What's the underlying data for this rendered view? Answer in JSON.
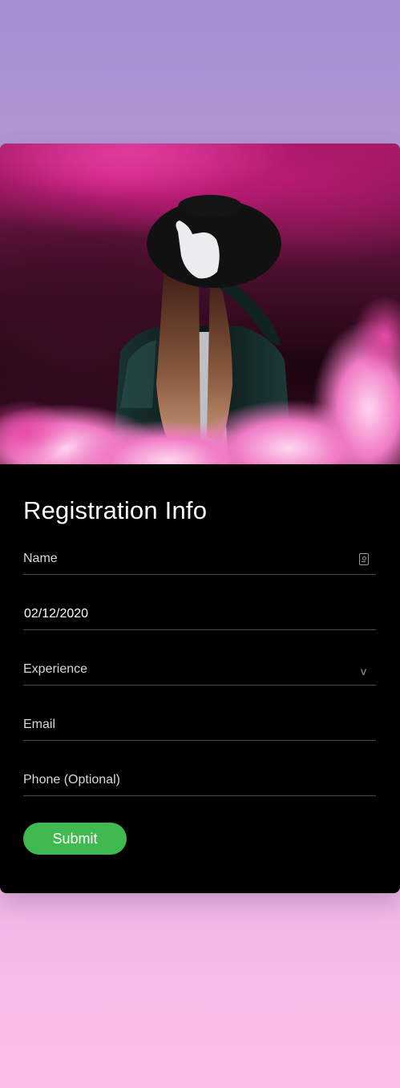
{
  "form": {
    "title": "Registration Info",
    "name_placeholder": "Name",
    "date_value": "02/12/2020",
    "experience_placeholder": "Experience",
    "email_placeholder": "Email",
    "phone_placeholder": "Phone (Optional)",
    "submit_label": "Submit",
    "chevron_glyph": "v"
  },
  "colors": {
    "accent": "#3fb950",
    "card_bg": "#000000",
    "bg_top": "#a58fd0",
    "bg_bottom": "#fcbfe8"
  },
  "icons": {
    "name_field": "contact-card-icon",
    "experience_field": "chevron-down-icon"
  }
}
